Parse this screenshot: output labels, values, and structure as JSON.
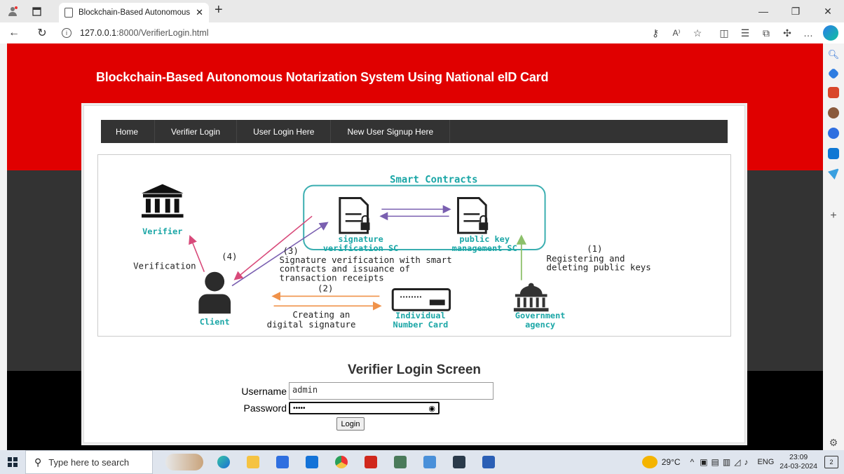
{
  "browser": {
    "tab_title": "Blockchain-Based Autonomous N",
    "url_host": "127.0.0.1",
    "url_path": ":8000/VerifierLogin.html",
    "reader_label": "A⁾"
  },
  "page": {
    "title": "Blockchain-Based Autonomous Notarization System Using National eID Card",
    "menu": [
      "Home",
      "Verifier Login",
      "User Login Here",
      "New User Signup Here"
    ]
  },
  "diagram": {
    "smart_contracts": "Smart Contracts",
    "sig_sc_line1": "signature",
    "sig_sc_line2": "verification SC",
    "pk_sc_line1": "public key",
    "pk_sc_line2": "management SC",
    "verifier": "Verifier",
    "client": "Client",
    "id_card_line1": "Individual",
    "id_card_line2": "Number Card",
    "gov_line1": "Government",
    "gov_line2": "agency",
    "step1": "(1)",
    "step1_line1": "Registering and",
    "step1_line2": "deleting public keys",
    "step2": "(2)",
    "step2_line1": "Creating an",
    "step2_line2": "digital signature",
    "step3": "(3)",
    "step3_line1": "Signature verification with smart",
    "step3_line2": "contracts and issuance of",
    "step3_line3": "transaction receipts",
    "step4": "(4)",
    "verification": "Verification"
  },
  "login": {
    "heading": "Verifier Login Screen",
    "username_label": "Username",
    "username_value": "admin",
    "password_label": "Password",
    "password_mask": "•••••",
    "button_label": "Login"
  },
  "taskbar": {
    "search_placeholder": "Type here to search",
    "temperature": "29°C",
    "language": "ENG",
    "time": "23:09",
    "date": "24-03-2024",
    "notifications": "2"
  },
  "colors": {
    "header_red": "#e00000",
    "band_gray": "#333333",
    "teal": "#1aa6a6",
    "menu_bg": "#333333"
  }
}
